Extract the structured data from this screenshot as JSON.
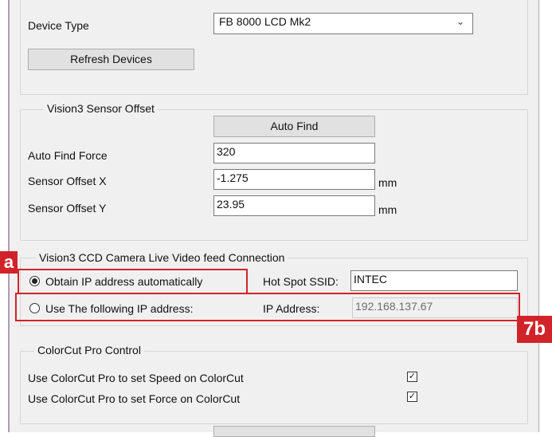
{
  "device": {
    "type_label": "Device Type",
    "type_value": "FB 8000 LCD Mk2",
    "refresh_label": "Refresh Devices"
  },
  "sensor_offset": {
    "legend": "Vision3 Sensor Offset",
    "auto_find_label": "Auto Find",
    "force_label": "Auto Find Force",
    "force_value": "320",
    "x_label": "Sensor Offset X",
    "x_value": "-1.275",
    "y_label": "Sensor Offset Y",
    "y_value": "23.95",
    "unit": "mm"
  },
  "camera": {
    "legend": "Vision3 CCD Camera Live Video feed Connection",
    "auto_ip_label": "Obtain IP address automatically",
    "auto_ip_selected": true,
    "manual_ip_label": "Use The following IP address:",
    "manual_ip_selected": false,
    "ssid_label": "Hot Spot SSID:",
    "ssid_value": "INTEC",
    "ip_label": "IP Address:",
    "ip_value": "192.168.137.67"
  },
  "colorcut": {
    "legend": "ColorCut Pro Control",
    "speed_label": "Use ColorCut Pro to set Speed on ColorCut",
    "speed_checked": true,
    "force_label": "Use ColorCut Pro to set Force on ColorCut",
    "force_checked": true
  },
  "annotations": {
    "tag_a": "a",
    "tag_7b": "7b",
    "highlight_color": "#d2232a"
  },
  "icons": {
    "dropdown": "chevron-down-icon",
    "check_mark": "✓"
  }
}
